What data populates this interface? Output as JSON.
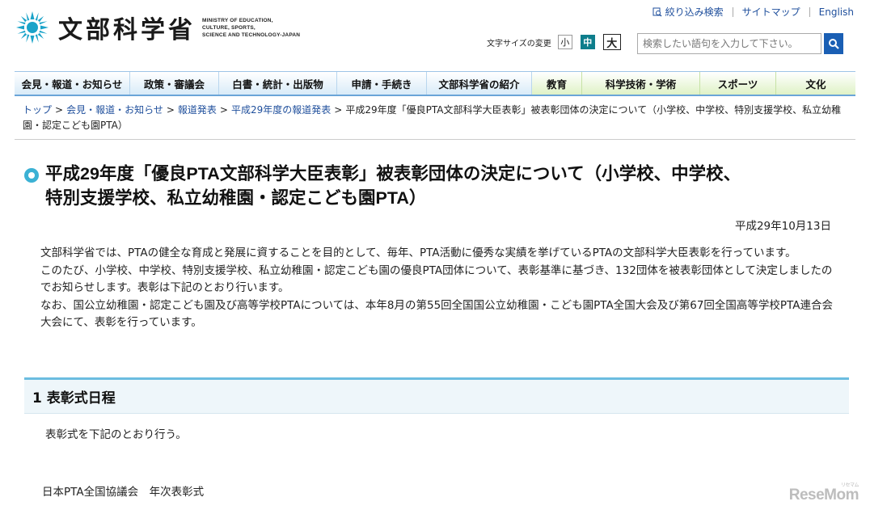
{
  "header": {
    "logo_jp": "文部科学省",
    "logo_en": [
      "MINISTRY OF EDUCATION,",
      "CULTURE, SPORTS,",
      "SCIENCE AND TECHNOLOGY-JAPAN"
    ],
    "util_links": [
      "絞り込み検索",
      "サイトマップ",
      "English"
    ],
    "font_size_label": "文字サイズの変更",
    "font_size_options": [
      "小",
      "中",
      "大"
    ],
    "font_size_selected": "中",
    "search_placeholder": "検索したい語句を入力して下さい。",
    "accent_color": "#1a5fb4"
  },
  "nav": [
    {
      "label": "会見・報道・お知らせ",
      "theme": "blue"
    },
    {
      "label": "政策・審議会",
      "theme": "blue"
    },
    {
      "label": "白書・統計・出版物",
      "theme": "blue"
    },
    {
      "label": "申請・手続き",
      "theme": "blue"
    },
    {
      "label": "文部科学省の紹介",
      "theme": "blue"
    },
    {
      "label": "教育",
      "theme": "green"
    },
    {
      "label": "科学技術・学術",
      "theme": "green"
    },
    {
      "label": "スポーツ",
      "theme": "green"
    },
    {
      "label": "文化",
      "theme": "green"
    }
  ],
  "breadcrumb": {
    "links": [
      "トップ",
      "会見・報道・お知らせ",
      "報道発表",
      "平成29年度の報道発表"
    ],
    "current": "平成29年度「優良PTA文部科学大臣表彰」被表彰団体の決定について（小学校、中学校、特別支援学校、私立幼稚園・認定こども園PTA）"
  },
  "page": {
    "title_line1": "平成29年度「優良PTA文部科学大臣表彰」被表彰団体の決定について（小学校、中学校、",
    "title_line2": "特別支援学校、私立幼稚園・認定こども園PTA）",
    "date": "平成29年10月13日",
    "paragraphs": [
      "文部科学省では、PTAの健全な育成と発展に資することを目的として、毎年、PTA活動に優秀な実績を挙げているPTAの文部科学大臣表彰を行っています。",
      "このたび、小学校、中学校、特別支援学校、私立幼稚園・認定こども園の優良PTA団体について、表彰基準に基づき、132団体を被表彰団体として決定しましたのでお知らせします。表彰は下記のとおり行います。",
      "なお、国公立幼稚園・認定こども園及び高等学校PTAについては、本年8月の第55回全国国公立幼稚園・こども園PTA全国大会及び第67回全国高等学校PTA連合会大会にて、表彰を行っています。"
    ],
    "section_title": "1 表彰式日程",
    "section_text": "表彰式を下記のとおり行う。",
    "event_text": "日本PTA全国協議会　年次表彰式"
  },
  "watermark": "ReseMom"
}
